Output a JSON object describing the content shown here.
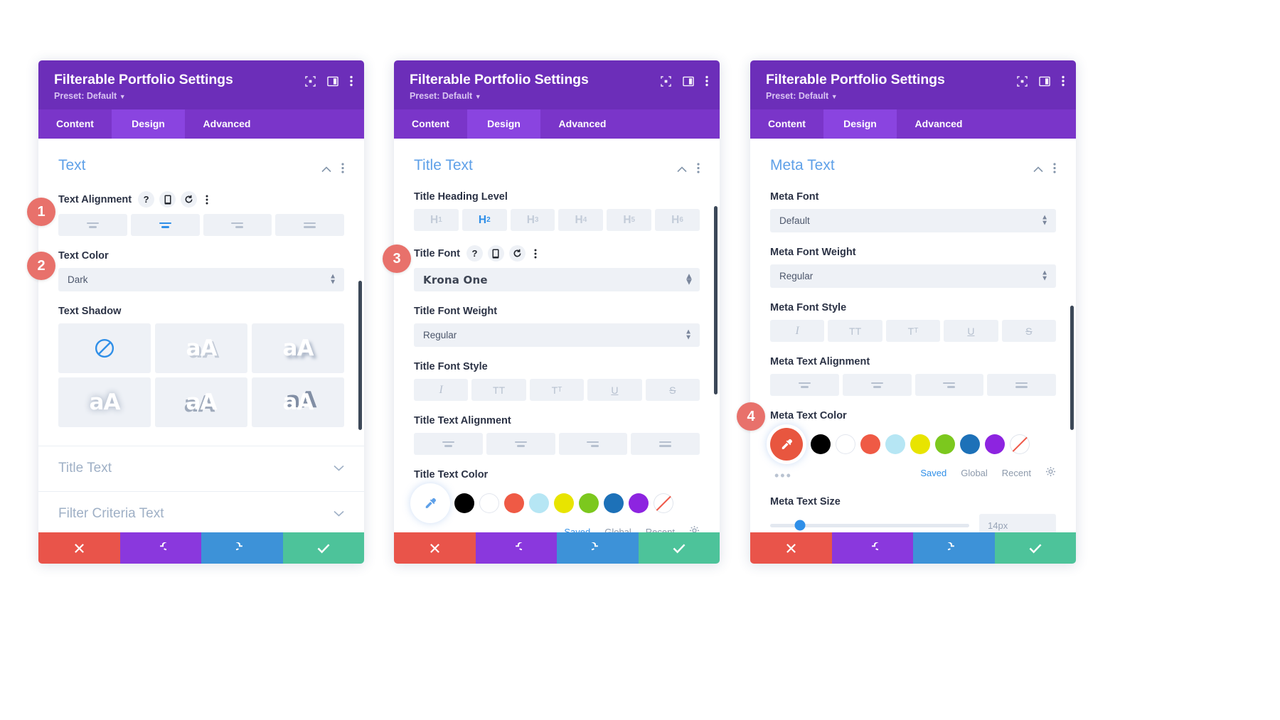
{
  "panels": [
    {
      "header": {
        "title": "Filterable Portfolio Settings",
        "preset": "Preset: Default"
      },
      "tabs": [
        {
          "label": "Content",
          "active": false
        },
        {
          "label": "Design",
          "active": true
        },
        {
          "label": "Advanced",
          "active": false
        }
      ],
      "section_title": "Text",
      "fields": {
        "text_alignment_label": "Text Alignment",
        "text_color_label": "Text Color",
        "text_color_value": "Dark",
        "text_shadow_label": "Text Shadow"
      },
      "collapsed_sections": [
        {
          "label": "Title Text"
        },
        {
          "label": "Filter Criteria Text"
        }
      ]
    },
    {
      "header": {
        "title": "Filterable Portfolio Settings",
        "preset": "Preset: Default"
      },
      "tabs": [
        {
          "label": "Content",
          "active": false
        },
        {
          "label": "Design",
          "active": true
        },
        {
          "label": "Advanced",
          "active": false
        }
      ],
      "section_title": "Title Text",
      "fields": {
        "heading_level_label": "Title Heading Level",
        "heading_levels": [
          "H1",
          "H2",
          "H3",
          "H4",
          "H5",
          "H6"
        ],
        "heading_level_active": "H2",
        "title_font_label": "Title Font",
        "title_font_value": "Krona One",
        "title_font_weight_label": "Title Font Weight",
        "title_font_weight_value": "Regular",
        "title_font_style_label": "Title Font Style",
        "title_text_alignment_label": "Title Text Alignment",
        "title_text_color_label": "Title Text Color"
      }
    },
    {
      "header": {
        "title": "Filterable Portfolio Settings",
        "preset": "Preset: Default"
      },
      "tabs": [
        {
          "label": "Content",
          "active": false
        },
        {
          "label": "Design",
          "active": true
        },
        {
          "label": "Advanced",
          "active": false
        }
      ],
      "section_title": "Meta Text",
      "fields": {
        "meta_font_label": "Meta Font",
        "meta_font_value": "Default",
        "meta_font_weight_label": "Meta Font Weight",
        "meta_font_weight_value": "Regular",
        "meta_font_style_label": "Meta Font Style",
        "meta_text_alignment_label": "Meta Text Alignment",
        "meta_text_color_label": "Meta Text Color",
        "meta_text_size_label": "Meta Text Size",
        "meta_text_size_value": "14px"
      }
    }
  ],
  "font_style_buttons": [
    {
      "name": "italic",
      "glyph": "I"
    },
    {
      "name": "uppercase",
      "glyph": "TT"
    },
    {
      "name": "small-caps",
      "glyph": "T"
    },
    {
      "name": "underline",
      "glyph": "U"
    },
    {
      "name": "strikethrough",
      "glyph": "S"
    }
  ],
  "color_palette": [
    {
      "name": "black",
      "hex": "#000000"
    },
    {
      "name": "white",
      "hex": "#ffffff"
    },
    {
      "name": "coral",
      "hex": "#ef5a45"
    },
    {
      "name": "light-blue",
      "hex": "#b6e6f4"
    },
    {
      "name": "yellow",
      "hex": "#e8e400"
    },
    {
      "name": "green",
      "hex": "#7cc81e"
    },
    {
      "name": "blue",
      "hex": "#1d71b8"
    },
    {
      "name": "purple",
      "hex": "#8d24e0"
    },
    {
      "name": "transparent",
      "hex": "none"
    }
  ],
  "swatch_footer": {
    "more": "•••",
    "saved": "Saved",
    "global": "Global",
    "recent": "Recent"
  },
  "footer_buttons": [
    {
      "name": "cancel-button",
      "icon": "close-icon"
    },
    {
      "name": "undo-button",
      "icon": "undo-icon"
    },
    {
      "name": "redo-button",
      "icon": "redo-icon"
    },
    {
      "name": "save-button",
      "icon": "check-icon"
    }
  ],
  "badges": [
    {
      "number": "1"
    },
    {
      "number": "2"
    },
    {
      "number": "3"
    },
    {
      "number": "4"
    }
  ],
  "colors": {
    "header_purple": "#6c2eb9",
    "tab_bar_purple": "#7a35c9",
    "tab_active_purple": "#8a44e0",
    "accent_blue": "#2f8fe8",
    "section_title_blue": "#5ea0e8",
    "badge_red": "#e8716b",
    "cancel_red": "#e9544a",
    "undo_purple": "#8a38dd",
    "redo_blue": "#3d92d8",
    "save_green": "#4dc39a",
    "eyedropper_orange": "#e8563f"
  }
}
